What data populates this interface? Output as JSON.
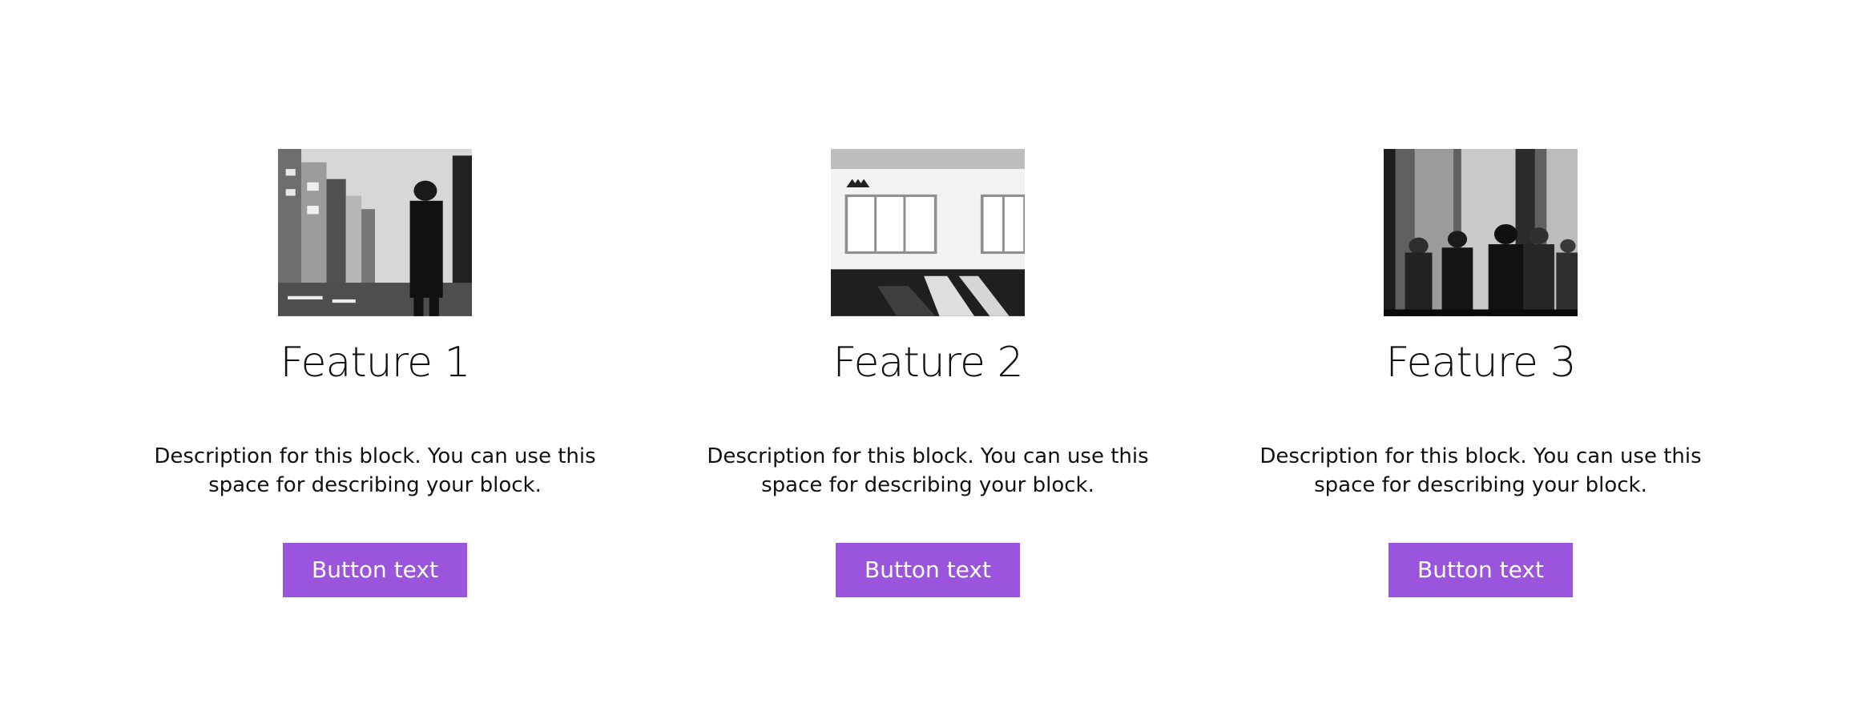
{
  "features": [
    {
      "image_subject": "person standing on a city street",
      "title": "Feature 1",
      "description": "Description for this block. You can use this space for describing your block.",
      "button_label": "Button text"
    },
    {
      "image_subject": "empty office room with windows",
      "title": "Feature 2",
      "description": "Description for this block. You can use this space for describing your block.",
      "button_label": "Button text"
    },
    {
      "image_subject": "group of people in a meeting",
      "title": "Feature 3",
      "description": "Description for this block. You can use this space for describing your block.",
      "button_label": "Button text"
    }
  ],
  "colors": {
    "button_background": "#9b55dc",
    "button_text": "#ffffff",
    "text": "#111111",
    "page_background": "#ffffff"
  }
}
